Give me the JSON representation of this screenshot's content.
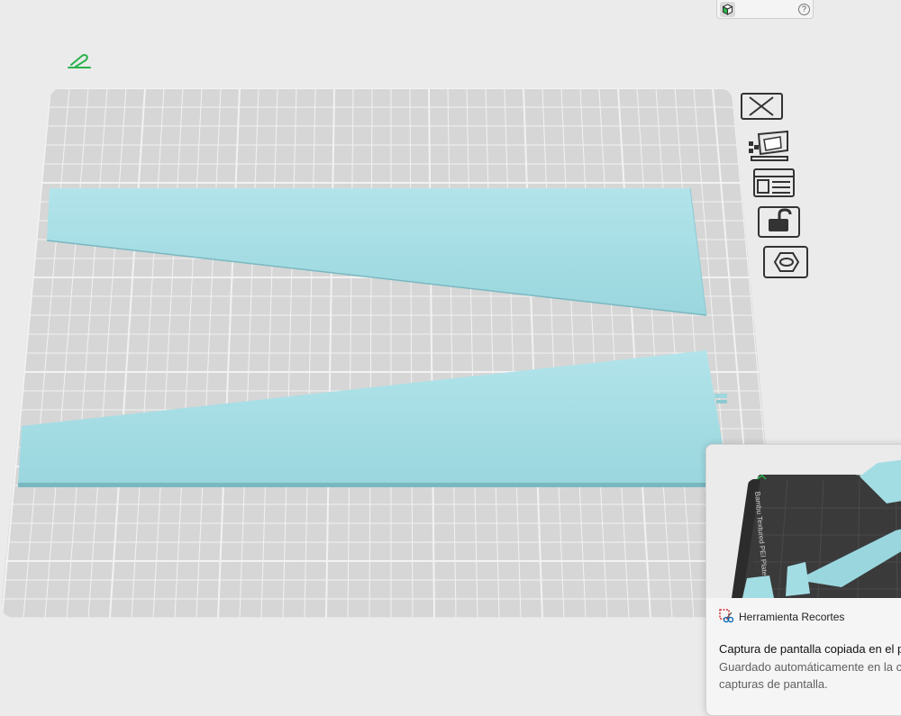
{
  "plate_preview_label": "Bambu Textured PEI Plate",
  "help_glyph": "?",
  "notification": {
    "app_name": "Herramienta Recortes",
    "title": "Captura de pantalla copiada en el p",
    "body_line1": "Guardado automáticamente en la c",
    "body_line2": "capturas de pantalla."
  },
  "colors": {
    "background": "#ebebeb",
    "plate": "#d6d6d6",
    "grid_line": "#f2f2f2",
    "model": "#a3dde4",
    "model_shade": "#79b8c0",
    "edit_icon": "#2bb24c"
  },
  "icons": [
    "edit-icon",
    "cube-view-icon",
    "help-icon",
    "close-icon",
    "auto-orient-icon",
    "arrange-icon",
    "lock-icon",
    "hexagon-nut-icon",
    "snipping-tool-icon"
  ]
}
